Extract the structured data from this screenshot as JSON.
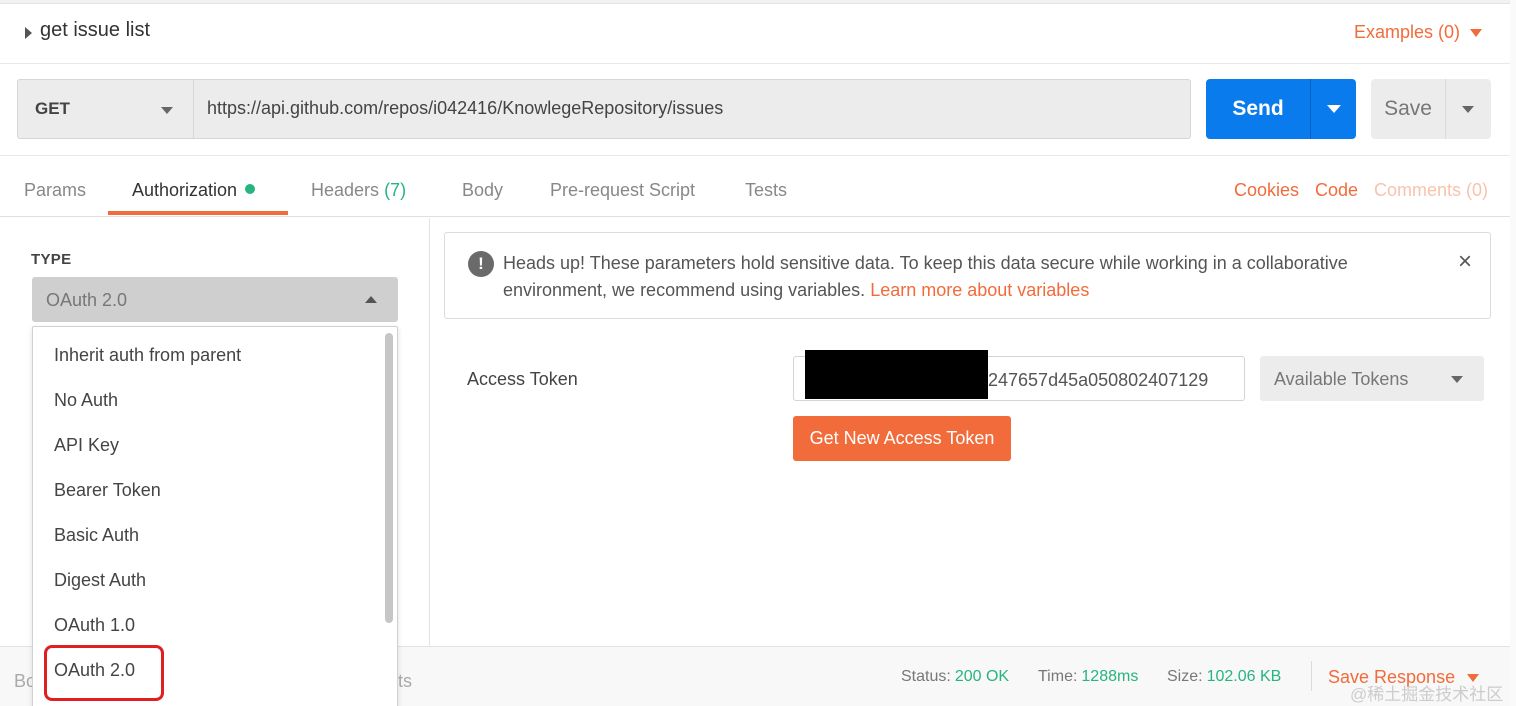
{
  "request": {
    "title": "get issue list",
    "examples_label": "Examples (0)"
  },
  "url_bar": {
    "method": "GET",
    "url": "https://api.github.com/repos/i042416/KnowlegeRepository/issues",
    "send_label": "Send",
    "save_label": "Save"
  },
  "tabs": {
    "params": "Params",
    "authorization": "Authorization",
    "headers": "Headers",
    "headers_count": "(7)",
    "body": "Body",
    "prerequest": "Pre-request Script",
    "tests": "Tests",
    "cookies": "Cookies",
    "code": "Code",
    "comments": "Comments (0)"
  },
  "auth": {
    "type_label": "TYPE",
    "selected_type": "OAuth 2.0",
    "options": [
      "Inherit auth from parent",
      "No Auth",
      "API Key",
      "Bearer Token",
      "Basic Auth",
      "Digest Auth",
      "OAuth 1.0",
      "OAuth 2.0"
    ]
  },
  "notice": {
    "text": "Heads up! These parameters hold sensitive data. To keep this data secure while working in a collaborative environment, we recommend using variables.",
    "link": "Learn more about variables"
  },
  "token": {
    "label": "Access Token",
    "value_visible": "247657d45a050802407129",
    "available_label": "Available Tokens",
    "new_token_label": "Get New Access Token"
  },
  "status_bar": {
    "left_fragment": "Bo",
    "mid_fragment": "ts",
    "status_label": "Status:",
    "status_value": "200 OK",
    "time_label": "Time:",
    "time_value": "1288ms",
    "size_label": "Size:",
    "size_value": "102.06 KB",
    "save_response": "Save Response",
    "watermark": "@稀土掘金技术社区"
  },
  "colors": {
    "accent_orange": "#f26b3a",
    "send_blue": "#097bed",
    "success_green": "#26b47f"
  }
}
